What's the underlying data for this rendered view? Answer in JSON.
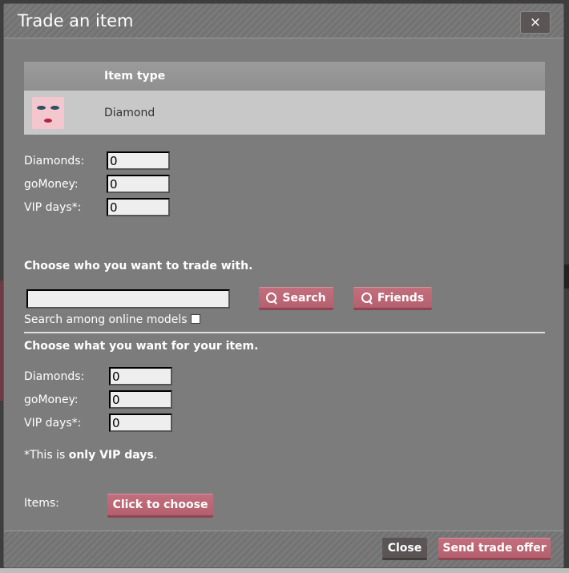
{
  "dialog": {
    "title": "Trade an item",
    "close_glyph": "×"
  },
  "items_table": {
    "header": "Item type",
    "row": {
      "item_name": "Diamond"
    }
  },
  "offer": {
    "diamonds_label": "Diamonds:",
    "diamonds_value": "0",
    "gomoney_label": "goMoney:",
    "gomoney_value": "0",
    "vip_label": "VIP days*:",
    "vip_value": "0"
  },
  "trade_with": {
    "heading": "Choose who you want to trade with.",
    "search_value": "",
    "search_button": "Search",
    "friends_button": "Friends",
    "online_label": "Search among online models"
  },
  "want": {
    "heading": "Choose what you want for your item.",
    "diamonds_label": "Diamonds:",
    "diamonds_value": "0",
    "gomoney_label": "goMoney:",
    "gomoney_value": "0",
    "vip_label": "VIP days*:",
    "vip_value": "0"
  },
  "note": {
    "prefix": "*This is ",
    "emphasis": "only VIP days",
    "suffix": "."
  },
  "items": {
    "label": "Items:",
    "choose_button": "Click to choose"
  },
  "footer": {
    "close_button": "Close",
    "send_button": "Send trade offer"
  },
  "colors": {
    "accent_pink": "#c26f7d",
    "dialog_bg": "#7c7c7c",
    "dark_button": "#5b5556"
  },
  "icons": [
    "close-icon",
    "search-icon",
    "friends-search-icon"
  ]
}
